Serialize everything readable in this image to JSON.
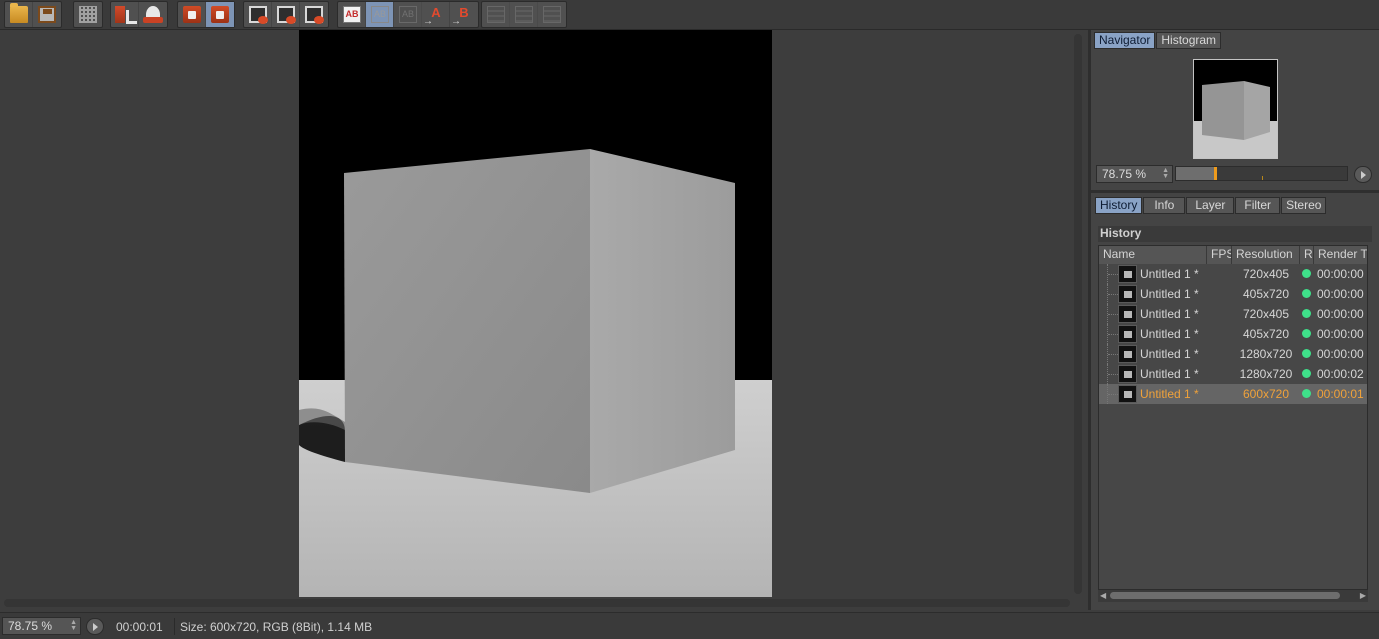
{
  "toolbar": {
    "groups": [
      {
        "buttons": [
          "open-icon",
          "save-icon"
        ]
      },
      {
        "buttons": [
          "grid-icon"
        ]
      },
      {
        "buttons": [
          "download-icon",
          "user-icon"
        ]
      },
      {
        "buttons": [
          "clip-icon",
          "clip-active-icon"
        ]
      },
      {
        "buttons": [
          "view-icon",
          "view-icon",
          "view-cam-icon"
        ]
      },
      {
        "buttons": [
          "ab-compare-icon",
          "ab-split-icon",
          "ab-disabled-icon",
          "set-a-icon",
          "set-b-icon"
        ]
      },
      {
        "buttons": [
          "compare-1-icon",
          "compare-2-icon",
          "compare-3-icon"
        ]
      }
    ],
    "ab_text": "AB",
    "a_text": "A",
    "b_text": "B"
  },
  "navigator": {
    "tabs": [
      "Navigator",
      "Histogram"
    ],
    "active_tab": "Navigator",
    "zoom_value": "78.75 %",
    "zoom_fraction": 0.22
  },
  "history_panel": {
    "tabs": [
      "History",
      "Info",
      "Layer",
      "Filter",
      "Stereo"
    ],
    "active_tab": "History",
    "header": "History",
    "columns": [
      "Name",
      "FPS",
      "Resolution",
      "R",
      "Render Ti"
    ],
    "rows": [
      {
        "name": "Untitled 1 *",
        "resolution": "720x405",
        "time": "00:00:00",
        "status_color": "#3fe08a",
        "selected": false
      },
      {
        "name": "Untitled 1 *",
        "resolution": "405x720",
        "time": "00:00:00",
        "status_color": "#3fe08a",
        "selected": false
      },
      {
        "name": "Untitled 1 *",
        "resolution": "720x405",
        "time": "00:00:00",
        "status_color": "#3fe08a",
        "selected": false
      },
      {
        "name": "Untitled 1 *",
        "resolution": "405x720",
        "time": "00:00:00",
        "status_color": "#3fe08a",
        "selected": false
      },
      {
        "name": "Untitled 1 *",
        "resolution": "1280x720",
        "time": "00:00:00",
        "status_color": "#3fe08a",
        "selected": false
      },
      {
        "name": "Untitled 1 *",
        "resolution": "1280x720",
        "time": "00:00:02",
        "status_color": "#3fe08a",
        "selected": false
      },
      {
        "name": "Untitled 1 *",
        "resolution": "600x720",
        "time": "00:00:01",
        "status_color": "#3fe08a",
        "selected": true
      }
    ],
    "selected_color": "#f0a23a"
  },
  "statusbar": {
    "zoom_value": "78.75 %",
    "render_time": "00:00:01",
    "info": "Size: 600x720, RGB (8Bit), 1.14 MB"
  },
  "colors": {
    "active_tab": "#8aa3c6",
    "accent_orange": "#ef9b1c",
    "status_green": "#3fe08a"
  }
}
